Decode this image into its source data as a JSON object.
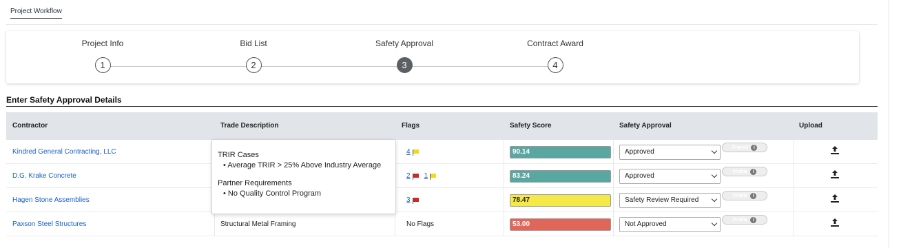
{
  "breadcrumb": {
    "tab": "Project Workflow"
  },
  "stepper": {
    "steps": [
      {
        "label": "Project Info",
        "number": "1"
      },
      {
        "label": "Bid List",
        "number": "2"
      },
      {
        "label": "Safety Approval",
        "number": "3"
      },
      {
        "label": "Contract Award",
        "number": "4"
      }
    ],
    "active_step": 3
  },
  "section": {
    "title": "Enter Safety Approval Details"
  },
  "table": {
    "columns": [
      "Contractor",
      "Trade Description",
      "Flags",
      "Safety Score",
      "Safety Approval",
      "Upload"
    ],
    "rows": [
      {
        "contractor": "Kindred General Contracting, LLC",
        "trade": "",
        "flags": [
          {
            "count": "4",
            "color": "yellow"
          }
        ],
        "no_flags": "",
        "score": "90.14",
        "score_color": "#5aa6a0",
        "approval": "Approved",
        "pill": "Project"
      },
      {
        "contractor": "D.G. Krake Concrete",
        "trade": "",
        "flags": [
          {
            "count": "2",
            "color": "red"
          },
          {
            "count": "1",
            "color": "yellow"
          }
        ],
        "no_flags": "",
        "score": "83.24",
        "score_color": "#5aa6a0",
        "approval": "Approved",
        "pill": "Profile"
      },
      {
        "contractor": "Hagen Stone Assemblies",
        "trade": "",
        "flags": [
          {
            "count": "3",
            "color": "red"
          }
        ],
        "no_flags": "",
        "score": "78.47",
        "score_color": "#f5e948",
        "approval": "Safety Review Required",
        "pill": "Profile"
      },
      {
        "contractor": "Paxson Steel Structures",
        "trade": "Structural Metal Framing",
        "flags": [],
        "no_flags": "No Flags",
        "score": "53.00",
        "score_color": "#e0665a",
        "approval": "Not Approved",
        "pill": "Profile"
      }
    ]
  },
  "tooltip": {
    "heading1": "TRIR Cases",
    "item1": "Average TRIR > 25% Above Industry Average",
    "heading2": "Partner Requirements",
    "item2": "No Quality Control Program"
  }
}
